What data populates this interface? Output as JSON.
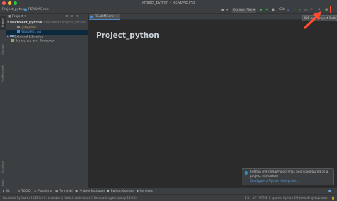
{
  "window": {
    "title": "Project_python – README.md"
  },
  "navbar": {
    "breadcrumb_project": "Project_python",
    "breadcrumb_file": "README.md",
    "run_config": "Current File",
    "git_label": "Git:"
  },
  "left_stripe": {
    "project_tab": "Project",
    "commit_tab": "Commit",
    "pull_requests_tab": "Pull Requests",
    "structure_tab": "Structure",
    "bookmarks_tab": "Bookmarks"
  },
  "project_panel": {
    "title": "Project",
    "tree": [
      {
        "label": "Project_python",
        "suffix": "~/Desktop/Project_python",
        "type": "folder",
        "level": 0
      },
      {
        "label": ".gitignore",
        "type": "file",
        "level": 2
      },
      {
        "label": "README.md",
        "type": "file",
        "level": 2,
        "selected": true
      },
      {
        "label": "External Libraries",
        "type": "folder",
        "level": 0
      },
      {
        "label": "Scratches and Consoles",
        "type": "folder",
        "level": 0
      }
    ]
  },
  "editor": {
    "tab_label": "README.md",
    "heading": "Project_python"
  },
  "tooltip": {
    "text": "IDE and Project Settings"
  },
  "notification": {
    "message": "Python 3.9 (tempProject) has been configured as a project interpreter",
    "link": "Configure a Python interpreter..."
  },
  "bottom_tools": [
    "Git",
    "TODO",
    "Problems",
    "Terminal",
    "Python Packages",
    "Python Console",
    "Services"
  ],
  "status_bar": {
    "message": "Localized PyCharm 2023.1.4 is available // Switch and restart // Don't ask again (today 18:20)",
    "position": "1:1",
    "line_sep": "LF",
    "encoding": "UTF-8",
    "indent": "4 spaces",
    "interpreter": "Python 3.9 (tempProject)",
    "branch": "main"
  },
  "colors": {
    "accent": "#4a88c7",
    "highlight": "#ff4d2e",
    "bg": "#2b2b2b",
    "panel": "#3c3f41"
  }
}
